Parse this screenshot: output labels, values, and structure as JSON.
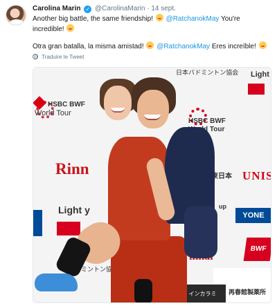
{
  "author": {
    "name": "Carolina Marin",
    "handle": "@CarolinaMarin",
    "separator": "·",
    "date": "14 sept.",
    "verified_icon": "verified-badge-icon",
    "avatar_icon": "profile-avatar"
  },
  "tweet": {
    "line1_text": "Another big battle, the same friendship!",
    "line1_mention": "@RatchanokMay",
    "line1_after": "You're incredible!",
    "line2_text": "Otra gran batalla, la misma amistad!",
    "line2_mention": "@RatchanokMay",
    "line2_after": "Eres increíble!"
  },
  "translate": {
    "label": "Traduire le Tweet",
    "icon": "globe-icon"
  },
  "photo": {
    "sponsors": {
      "hsbc_left": "HSBC BWF",
      "hsbc_left_sub": "World Tour",
      "hsbc_right": "HSBC BWF",
      "hsbc_right_sub": "World Tour",
      "rinnai_left": "Rinn",
      "rinnai_right": "innai",
      "unis": "UNIS",
      "light_top": "Light",
      "light_mid": "Light y",
      "nba_top": "日本バドミントン協会",
      "nba_bottom": "ドミントン協会",
      "nihon": "東日本",
      "up": "up",
      "yonex": "YONE",
      "bwf": "BWF",
      "bottom_bar": "X10 インカラミ",
      "stamp": "再春館製薬所"
    }
  },
  "colors": {
    "link": "#1b95e0",
    "verified": "#1da1f2",
    "muted": "#657786",
    "brand_red": "#c8141b"
  }
}
